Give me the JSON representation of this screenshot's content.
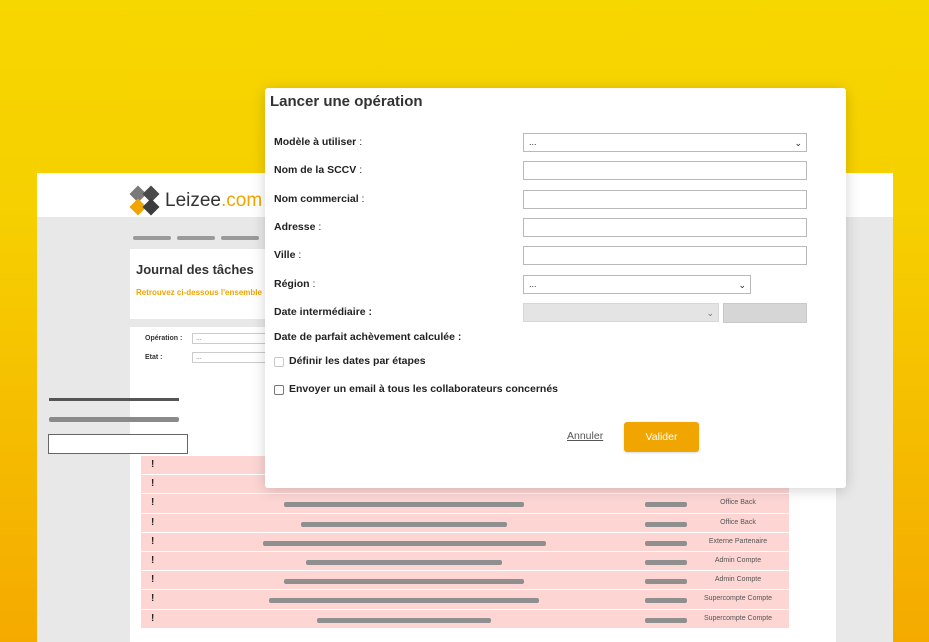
{
  "app": {
    "logo": {
      "name": "Leizee",
      "domain": ".com"
    },
    "journal": {
      "title": "Journal des tâches",
      "subtitle": "Retrouvez ci-dessous l'ensemble",
      "filters": [
        {
          "label": "Opération :",
          "value": "..."
        },
        {
          "label": "Etat :",
          "value": "..."
        }
      ],
      "rows": [
        {
          "mark": "!",
          "role": ""
        },
        {
          "mark": "!",
          "role": ""
        },
        {
          "mark": "!",
          "role": "Office Back"
        },
        {
          "mark": "!",
          "role": "Office Back"
        },
        {
          "mark": "!",
          "role": "Externe Partenaire"
        },
        {
          "mark": "!",
          "role": "Admin Compte"
        },
        {
          "mark": "!",
          "role": "Admin Compte"
        },
        {
          "mark": "!",
          "role": "Supercompte Compte"
        },
        {
          "mark": "!",
          "role": "Supercompte Compte"
        }
      ]
    }
  },
  "modal": {
    "title": "Lancer une opération",
    "fields": {
      "modele": {
        "label": "Modèle à utiliser",
        "suffix": " :",
        "value": "..."
      },
      "nom_sccv": {
        "label": "Nom de la SCCV",
        "suffix": " :",
        "value": ""
      },
      "nom_commercial": {
        "label": "Nom commercial",
        "suffix": " :",
        "value": ""
      },
      "adresse": {
        "label": "Adresse",
        "suffix": " :",
        "value": ""
      },
      "ville": {
        "label": "Ville",
        "suffix": " :",
        "value": ""
      },
      "region": {
        "label": "Région",
        "suffix": " :",
        "value": "..."
      },
      "date_intermediaire": {
        "label": "Date intermédiaire :",
        "value": ""
      },
      "date_achevement": {
        "label": "Date de parfait achèvement calculée :"
      }
    },
    "checkboxes": {
      "dates_par_etapes": {
        "label": "Définir les dates par étapes",
        "checked": false,
        "disabled": true
      },
      "envoyer_email": {
        "label": "Envoyer un email à tous les collaborateurs concernés",
        "checked": false,
        "disabled": false
      }
    },
    "actions": {
      "cancel": "Annuler",
      "submit": "Valider"
    }
  },
  "colors": {
    "accent": "#f0a500",
    "row_highlight": "#fdd6d4",
    "background_top": "#f7d700"
  },
  "icons": {
    "select_chevron": "chevron-down-icon",
    "logo": "leizee-logo-icon"
  }
}
